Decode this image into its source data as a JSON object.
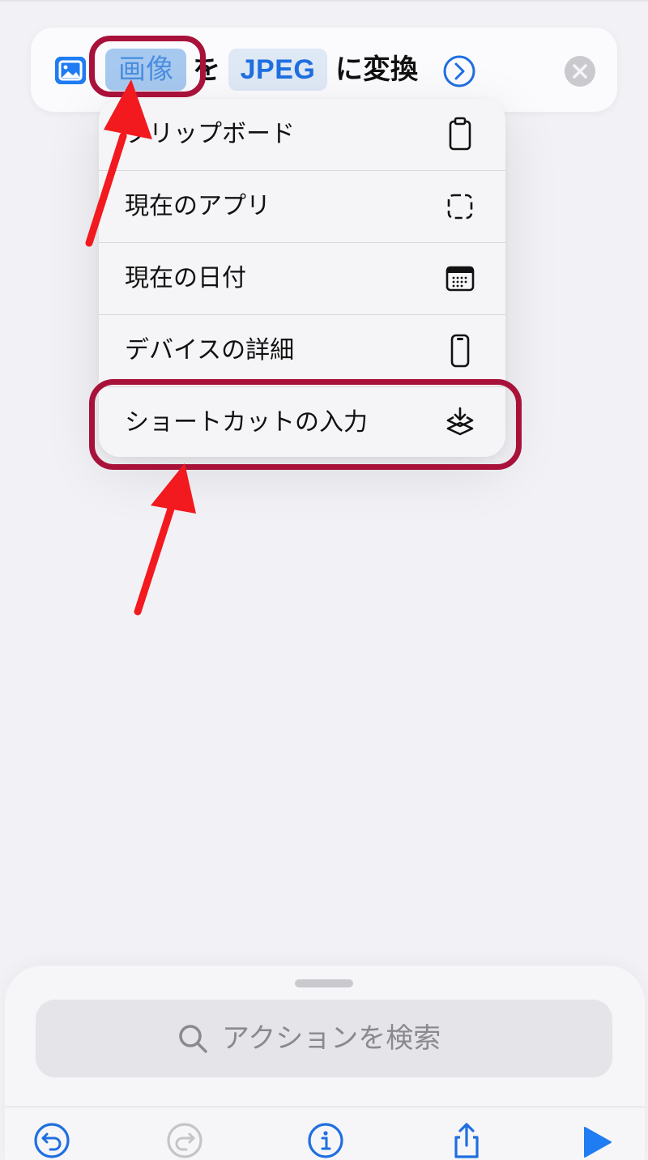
{
  "action": {
    "input_token": "画像",
    "particle": "を",
    "format_token": "JPEG",
    "verb": "に変換"
  },
  "menu": {
    "items": [
      {
        "label": "クリップボード",
        "icon": "clipboard-icon"
      },
      {
        "label": "現在のアプリ",
        "icon": "dashed-square-icon"
      },
      {
        "label": "現在の日付",
        "icon": "calendar-icon"
      },
      {
        "label": "デバイスの詳細",
        "icon": "iphone-icon"
      },
      {
        "label": "ショートカットの入力",
        "icon": "shortcuts-input-icon"
      }
    ]
  },
  "search": {
    "placeholder": "アクションを検索"
  },
  "toolbar": {
    "icons": [
      "undo-icon",
      "redo-icon",
      "info-icon",
      "share-icon",
      "play-icon"
    ]
  },
  "colors": {
    "accent": "#1f7cf2",
    "highlight_annotation": "#a8123a",
    "arrow_annotation": "#f2191f"
  }
}
